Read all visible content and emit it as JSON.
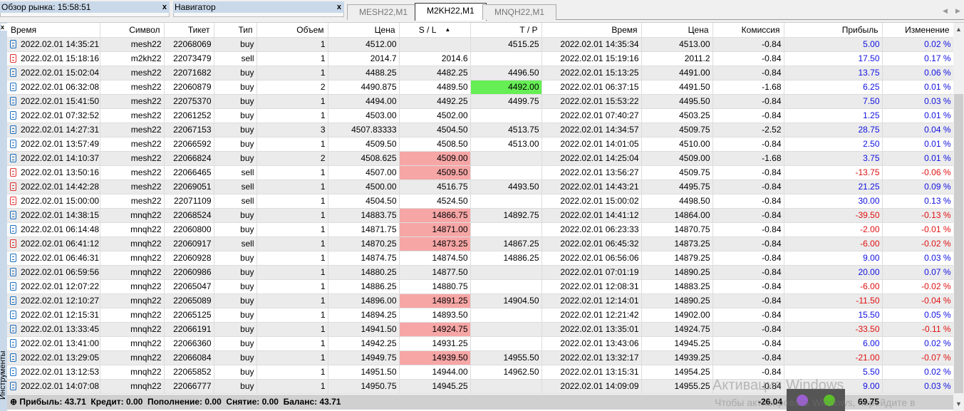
{
  "panels": {
    "market_watch": "Обзор рынка: 15:58:51",
    "navigator": "Навигатор",
    "close": "x"
  },
  "chart_tabs": [
    {
      "label": "MESH22,M1",
      "active": false
    },
    {
      "label": "M2KH22,M1",
      "active": true
    },
    {
      "label": "MNQH22,M1",
      "active": false
    }
  ],
  "side_label": "Инструменты",
  "columns": [
    "Время",
    "Символ",
    "Тикет",
    "Тип",
    "Объем",
    "Цена",
    "S / L",
    "T / P",
    "Время",
    "Цена",
    "Комиссия",
    "Прибыль",
    "Изменение"
  ],
  "sort_indicator": "▲",
  "rows": [
    [
      "2022.02.01 14:35:21",
      "mesh22",
      "22068069",
      "buy",
      "1",
      "4512.00",
      "",
      "4515.25",
      "2022.02.01 14:35:34",
      "4513.00",
      "-0.84",
      "5.00",
      "0.02 %"
    ],
    [
      "2022.02.01 15:18:16",
      "m2kh22",
      "22073479",
      "sell",
      "1",
      "2014.7",
      "2014.6",
      "",
      "2022.02.01 15:19:16",
      "2011.2",
      "-0.84",
      "17.50",
      "0.17 %"
    ],
    [
      "2022.02.01 15:02:04",
      "mesh22",
      "22071682",
      "buy",
      "1",
      "4488.25",
      "4482.25",
      "4496.50",
      "2022.02.01 15:13:25",
      "4491.00",
      "-0.84",
      "13.75",
      "0.06 %"
    ],
    [
      "2022.02.01 06:32:08",
      "mesh22",
      "22060879",
      "buy",
      "2",
      "4490.875",
      "4489.50",
      "4492.00",
      "2022.02.01 06:37:15",
      "4491.50",
      "-1.68",
      "6.25",
      "0.01 %"
    ],
    [
      "2022.02.01 15:41:50",
      "mesh22",
      "22075370",
      "buy",
      "1",
      "4494.00",
      "4492.25",
      "4499.75",
      "2022.02.01 15:53:22",
      "4495.50",
      "-0.84",
      "7.50",
      "0.03 %"
    ],
    [
      "2022.02.01 07:32:52",
      "mesh22",
      "22061252",
      "buy",
      "1",
      "4503.00",
      "4502.00",
      "",
      "2022.02.01 07:40:27",
      "4503.25",
      "-0.84",
      "1.25",
      "0.01 %"
    ],
    [
      "2022.02.01 14:27:31",
      "mesh22",
      "22067153",
      "buy",
      "3",
      "4507.83333",
      "4504.50",
      "4513.75",
      "2022.02.01 14:34:57",
      "4509.75",
      "-2.52",
      "28.75",
      "0.04 %"
    ],
    [
      "2022.02.01 13:57:49",
      "mesh22",
      "22066592",
      "buy",
      "1",
      "4509.50",
      "4508.50",
      "4513.00",
      "2022.02.01 14:01:05",
      "4510.00",
      "-0.84",
      "2.50",
      "0.01 %"
    ],
    [
      "2022.02.01 14:10:37",
      "mesh22",
      "22066824",
      "buy",
      "2",
      "4508.625",
      "4509.00",
      "",
      "2022.02.01 14:25:04",
      "4509.00",
      "-1.68",
      "3.75",
      "0.01 %"
    ],
    [
      "2022.02.01 13:50:16",
      "mesh22",
      "22066465",
      "sell",
      "1",
      "4507.00",
      "4509.50",
      "",
      "2022.02.01 13:56:27",
      "4509.75",
      "-0.84",
      "-13.75",
      "-0.06 %"
    ],
    [
      "2022.02.01 14:42:28",
      "mesh22",
      "22069051",
      "sell",
      "1",
      "4500.00",
      "4516.75",
      "4493.50",
      "2022.02.01 14:43:21",
      "4495.75",
      "-0.84",
      "21.25",
      "0.09 %"
    ],
    [
      "2022.02.01 15:00:00",
      "mesh22",
      "22071109",
      "sell",
      "1",
      "4504.50",
      "4524.50",
      "",
      "2022.02.01 15:00:02",
      "4498.50",
      "-0.84",
      "30.00",
      "0.13 %"
    ],
    [
      "2022.02.01 14:38:15",
      "mnqh22",
      "22068524",
      "buy",
      "1",
      "14883.75",
      "14866.75",
      "14892.75",
      "2022.02.01 14:41:12",
      "14864.00",
      "-0.84",
      "-39.50",
      "-0.13 %"
    ],
    [
      "2022.02.01 06:14:48",
      "mnqh22",
      "22060800",
      "buy",
      "1",
      "14871.75",
      "14871.00",
      "",
      "2022.02.01 06:23:33",
      "14870.75",
      "-0.84",
      "-2.00",
      "-0.01 %"
    ],
    [
      "2022.02.01 06:41:12",
      "mnqh22",
      "22060917",
      "sell",
      "1",
      "14870.25",
      "14873.25",
      "14867.25",
      "2022.02.01 06:45:32",
      "14873.25",
      "-0.84",
      "-6.00",
      "-0.02 %"
    ],
    [
      "2022.02.01 06:46:31",
      "mnqh22",
      "22060928",
      "buy",
      "1",
      "14874.75",
      "14874.50",
      "14886.25",
      "2022.02.01 06:56:06",
      "14879.25",
      "-0.84",
      "9.00",
      "0.03 %"
    ],
    [
      "2022.02.01 06:59:56",
      "mnqh22",
      "22060986",
      "buy",
      "1",
      "14880.25",
      "14877.50",
      "",
      "2022.02.01 07:01:19",
      "14890.25",
      "-0.84",
      "20.00",
      "0.07 %"
    ],
    [
      "2022.02.01 12:07:22",
      "mnqh22",
      "22065047",
      "buy",
      "1",
      "14886.25",
      "14880.75",
      "",
      "2022.02.01 12:08:31",
      "14883.25",
      "-0.84",
      "-6.00",
      "-0.02 %"
    ],
    [
      "2022.02.01 12:10:27",
      "mnqh22",
      "22065089",
      "buy",
      "1",
      "14896.00",
      "14891.25",
      "14904.50",
      "2022.02.01 12:14:01",
      "14890.25",
      "-0.84",
      "-11.50",
      "-0.04 %"
    ],
    [
      "2022.02.01 12:15:31",
      "mnqh22",
      "22065125",
      "buy",
      "1",
      "14894.25",
      "14893.50",
      "",
      "2022.02.01 12:21:42",
      "14902.00",
      "-0.84",
      "15.50",
      "0.05 %"
    ],
    [
      "2022.02.01 13:33:45",
      "mnqh22",
      "22066191",
      "buy",
      "1",
      "14941.50",
      "14924.75",
      "",
      "2022.02.01 13:35:01",
      "14924.75",
      "-0.84",
      "-33.50",
      "-0.11 %"
    ],
    [
      "2022.02.01 13:41:00",
      "mnqh22",
      "22066360",
      "buy",
      "1",
      "14942.25",
      "14931.25",
      "",
      "2022.02.01 13:43:06",
      "14945.25",
      "-0.84",
      "6.00",
      "0.02 %"
    ],
    [
      "2022.02.01 13:29:05",
      "mnqh22",
      "22066084",
      "buy",
      "1",
      "14949.75",
      "14939.50",
      "14955.50",
      "2022.02.01 13:32:17",
      "14939.25",
      "-0.84",
      "-21.00",
      "-0.07 %"
    ],
    [
      "2022.02.01 13:12:53",
      "mnqh22",
      "22065852",
      "buy",
      "1",
      "14951.50",
      "14944.00",
      "14962.50",
      "2022.02.01 13:15:31",
      "14954.25",
      "-0.84",
      "5.50",
      "0.02 %"
    ],
    [
      "2022.02.01 14:07:08",
      "mnqh22",
      "22066777",
      "buy",
      "1",
      "14950.75",
      "14945.25",
      "",
      "2022.02.01 14:09:09",
      "14955.25",
      "-0.84",
      "9.00",
      "0.03 %"
    ]
  ],
  "sl_hit_rows": [
    8,
    9,
    12,
    13,
    14,
    18,
    20,
    22
  ],
  "tp_hit_rows": [
    3
  ],
  "colors": {
    "sl_hit": "#f7a6a6",
    "tp_hit": "#66ee55",
    "profit_positive": "#1010e0",
    "profit_negative": "#e01010",
    "buy_icon": "#1a6fc0",
    "sell_icon": "#e03030"
  },
  "summary": {
    "text": "Прибыль: 43.71  Кредит: 0.00  Пополнение: 0.00  Снятие: 0.00  Баланс: 43.71",
    "commission_total": "-26.04",
    "profit_total": "69.75"
  },
  "watermark": {
    "line1": "Активация Windows",
    "line2": "Чтобы активировать Windows, перейдите в"
  }
}
